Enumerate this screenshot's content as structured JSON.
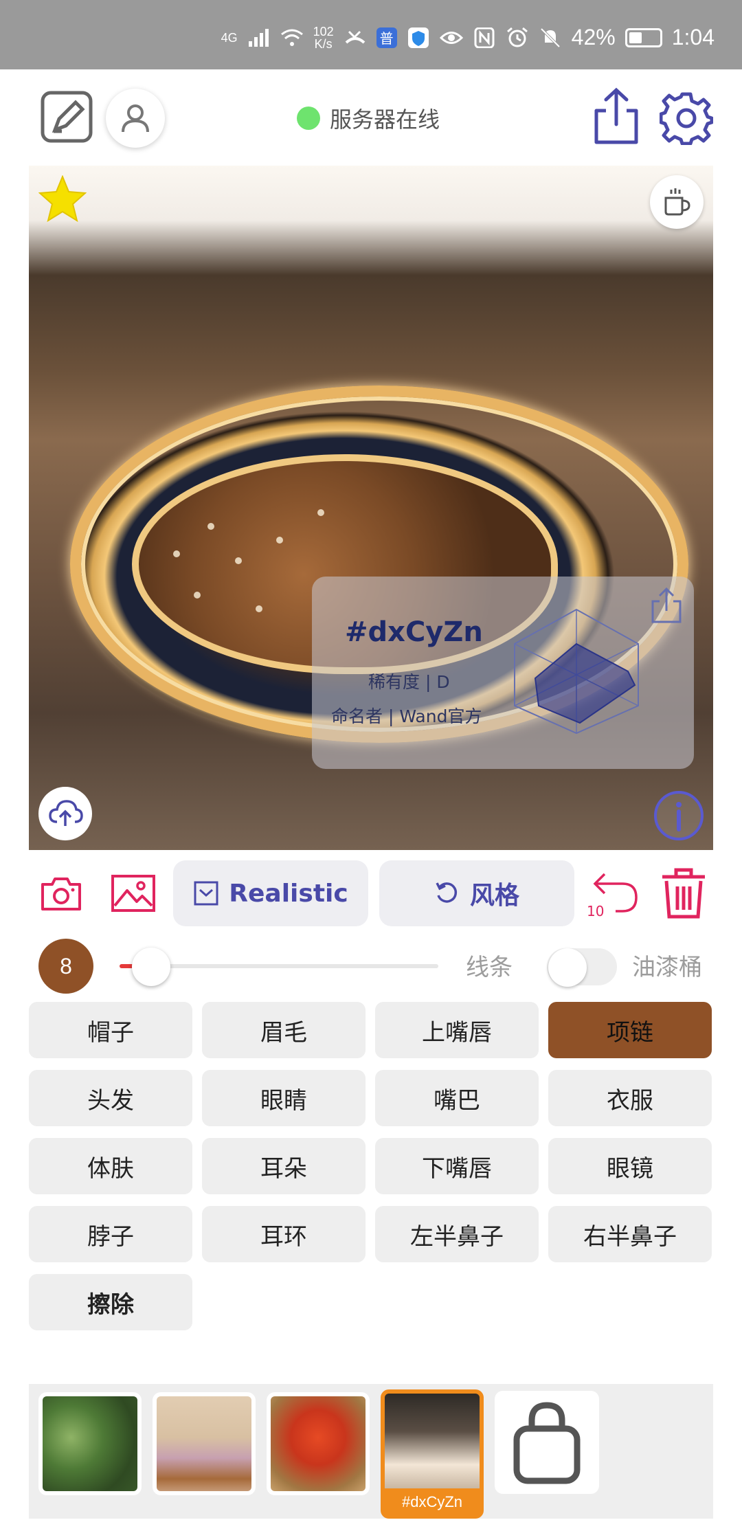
{
  "status_bar": {
    "network_type": "4G",
    "speed_value": "102",
    "speed_unit": "K/s",
    "badge_text": "普",
    "battery_percent": "42%",
    "time": "1:04"
  },
  "header": {
    "server_status": "服务器在线",
    "server_status_color": "#6ee36e"
  },
  "artwork": {
    "name": "#dxCyZn",
    "rarity": "稀有度 | D",
    "namer": "命名者 | Wand官方"
  },
  "toolbar": {
    "style_label": "Realistic",
    "restyle_label": "风格",
    "undo_count": "10"
  },
  "brush": {
    "size": "8",
    "slider_value": 0.06,
    "line_label": "线条",
    "bucket_label": "油漆桶",
    "bucket_on": false
  },
  "parts": [
    {
      "label": "帽子",
      "active": false
    },
    {
      "label": "眉毛",
      "active": false
    },
    {
      "label": "上嘴唇",
      "active": false
    },
    {
      "label": "项链",
      "active": true
    },
    {
      "label": "头发",
      "active": false
    },
    {
      "label": "眼睛",
      "active": false
    },
    {
      "label": "嘴巴",
      "active": false
    },
    {
      "label": "衣服",
      "active": false
    },
    {
      "label": "体肤",
      "active": false
    },
    {
      "label": "耳朵",
      "active": false
    },
    {
      "label": "下嘴唇",
      "active": false
    },
    {
      "label": "眼镜",
      "active": false
    },
    {
      "label": "脖子",
      "active": false
    },
    {
      "label": "耳环",
      "active": false
    },
    {
      "label": "左半鼻子",
      "active": false
    },
    {
      "label": "右半鼻子",
      "active": false
    },
    {
      "label": "擦除",
      "active": false
    }
  ],
  "gallery": {
    "selected_caption": "#dxCyZn"
  },
  "colors": {
    "accent": "#e0245e",
    "primary": "#4949a8",
    "brush_brown": "#8f5127",
    "selection_orange": "#f08c1c"
  }
}
